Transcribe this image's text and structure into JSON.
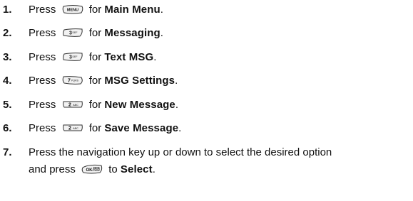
{
  "steps": [
    {
      "number": "1.",
      "prefix": "Press",
      "key": "MENU",
      "mid": "for",
      "target": "Main Menu",
      "suffix": "."
    },
    {
      "number": "2.",
      "prefix": "Press",
      "key": "3DEF",
      "mid": "for",
      "target": "Messaging",
      "suffix": "."
    },
    {
      "number": "3.",
      "prefix": "Press",
      "key": "3DEF",
      "mid": "for",
      "target": "Text MSG",
      "suffix": "."
    },
    {
      "number": "4.",
      "prefix": "Press",
      "key": "7PQRS",
      "mid": "for",
      "target": "MSG Settings",
      "suffix": "."
    },
    {
      "number": "5.",
      "prefix": "Press",
      "key": "2ABC",
      "mid": "for",
      "target": "New Message",
      "suffix": "."
    },
    {
      "number": "6.",
      "prefix": "Press",
      "key": "2ABC",
      "mid": "for",
      "target": "Save Message",
      "suffix": "."
    }
  ],
  "step7": {
    "number": "7.",
    "line1": "Press the navigation key up or down to select the desired option",
    "line2_prefix": "and press",
    "key": "OK",
    "line2_mid": "to",
    "target": "Select",
    "suffix": "."
  }
}
